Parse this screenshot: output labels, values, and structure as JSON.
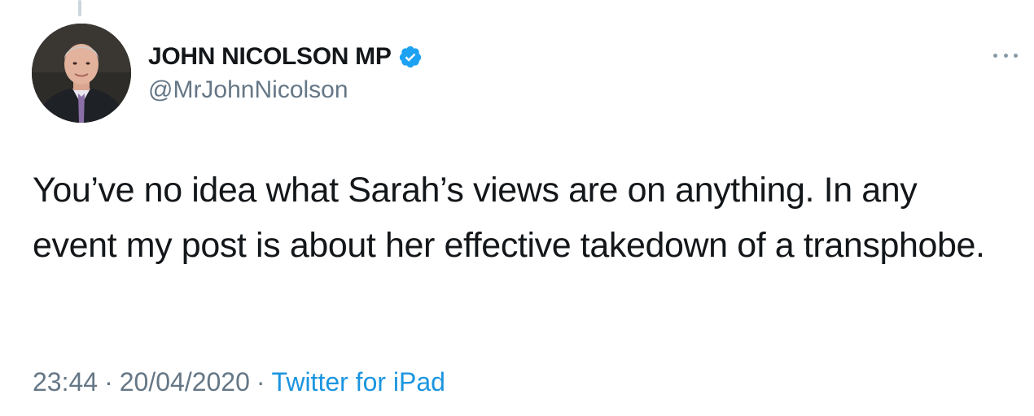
{
  "tweet": {
    "author": {
      "display_name": "JOHN NICOLSON MP",
      "handle": "@MrJohnNicolson",
      "verified_icon": "verified-badge-icon"
    },
    "text": "You’ve no idea what Sarah’s views are on anything. In any event my post is about her effective takedown of a transphobe.",
    "time": "23:44",
    "date": "20/04/2020",
    "separator": "·",
    "source": "Twitter for iPad",
    "more_icon": "more-options-icon"
  },
  "colors": {
    "text": "#14171a",
    "secondary": "#657786",
    "link": "#1b95e0",
    "verified": "#1da1f2",
    "thread_line": "#ccd6dd"
  }
}
